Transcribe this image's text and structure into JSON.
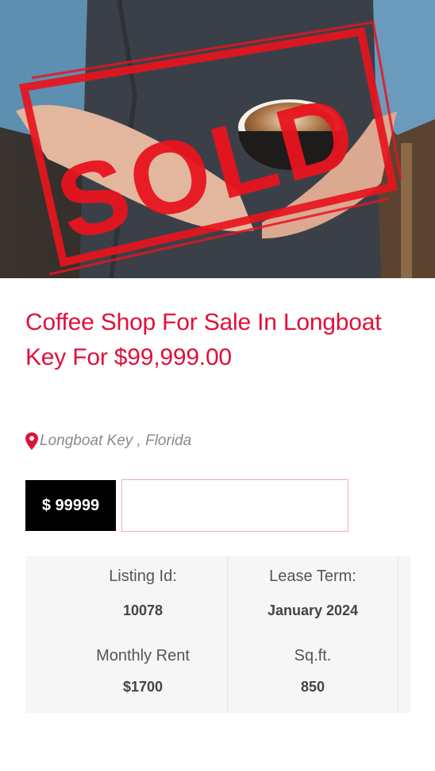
{
  "listing": {
    "image_alt": "Barista holding a latte with SOLD stamp",
    "stamp_text": "SOLD",
    "title": "Coffee Shop For Sale In Longboat Key For $99,999.00",
    "location_icon": "map-pin-icon",
    "location": "Longboat Key , Florida",
    "price_badge": "$ 99999",
    "details": {
      "listing_id_label": "Listing Id:",
      "listing_id_value": "10078",
      "lease_term_label": "Lease Term:",
      "lease_term_value": "January 2024",
      "monthly_rent_label": "Monthly Rent",
      "monthly_rent_value": "$1700",
      "sqft_label": "Sq.ft.",
      "sqft_value": "850"
    }
  },
  "colors": {
    "accent": "#e0103a",
    "stamp": "#e8141e",
    "badge_bg": "#000000",
    "details_bg": "#f6f6f6"
  }
}
